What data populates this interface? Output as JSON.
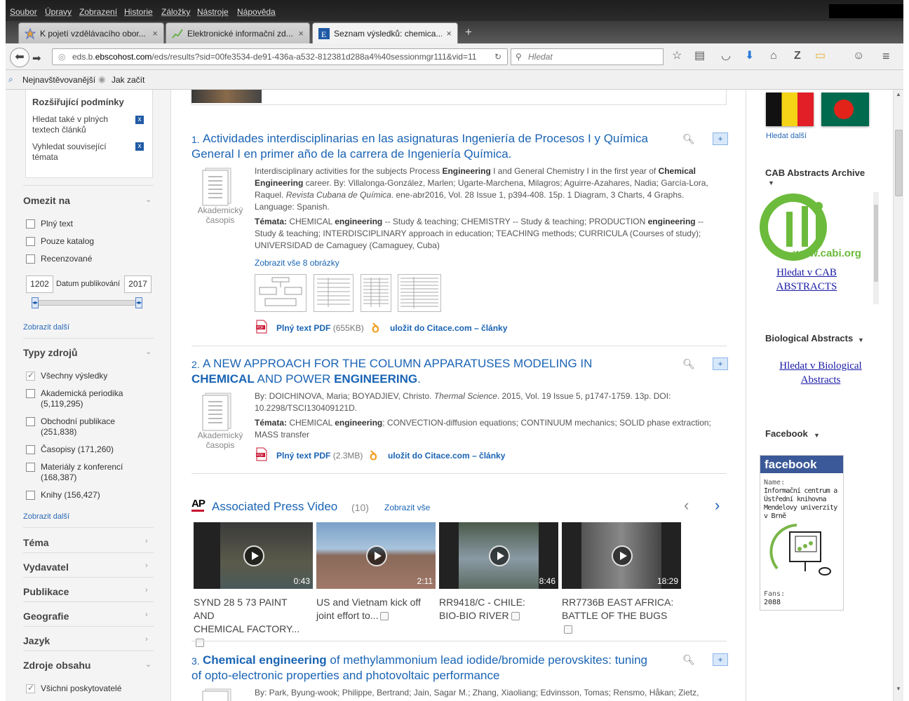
{
  "menu": [
    "Soubor",
    "Úpravy",
    "Zobrazení",
    "Historie",
    "Záložky",
    "Nástroje",
    "Nápověda"
  ],
  "tabs": [
    {
      "title": "K pojetí vzdělávacího obor...",
      "close": "×"
    },
    {
      "title": "Elektronické informační zd...",
      "close": "×"
    },
    {
      "title": "Seznam výsledků: chemica...",
      "close": "×"
    }
  ],
  "new_tab": "+",
  "url": {
    "prefix": "eds.b.",
    "domain": "ebscohost.com",
    "path": "/eds/results?sid=00fe3534-de91-436a-a532-812381d288a4%40sessionmgr111&vid=11"
  },
  "search_placeholder": "Hledat",
  "bookmarks": [
    "Nejnavštěvovanější",
    "Jak začít"
  ],
  "left": {
    "rozsirujici": "Rozšiřující podmínky",
    "opt1": "Hledat také v plných textech článků",
    "opt2": "Vyhledat související témata",
    "omezit": "Omezit na",
    "limits": [
      "Plný text",
      "Pouze katalog",
      "Recenzované"
    ],
    "date_from": "1202",
    "date_label": "Datum publikování",
    "date_to": "2017",
    "more": "Zobrazit další",
    "typy": "Typy zdrojů",
    "types": [
      "Všechny výsledky",
      "Akademická periodika (5,119,295)",
      "Obchodní publikace (251,838)",
      "Časopisy (171,260)",
      "Materiály z konferencí (168,387)",
      "Knihy (156,427)"
    ],
    "facets": [
      "Téma",
      "Vydavatel",
      "Publikace",
      "Geografie",
      "Jazyk",
      "Zdroje obsahu"
    ],
    "providers": "Všichni poskytovatelé"
  },
  "results": [
    {
      "num": "1.",
      "title": "Actividades interdisciplinarias en las asignaturas Ingeniería de Procesos I y Química General I en primer año de la carrera de Ingeniería Química.",
      "type": "Akademický časopis",
      "abstract_a": "Interdisciplinary activities for the subjects Process ",
      "kw1": "Engineering",
      "abstract_b": " I and General Chemistry I in the first year of ",
      "kw2": "Chemical",
      "abstract_c": " ",
      "kw3": "Engineering",
      "abstract_d": " career. By: Villalonga-González, Marlen; Ugarte-Marchena, Milagros; Aguirre-Azahares, Nadia; García-Lora, Raquel. ",
      "journal": "Revista Cubana de Química",
      "abstract_e": ". ene-abr2016, Vol. 28 Issue 1, p394-408. 15p. 1 Diagram, 3 Charts, 4 Graphs. Language: Spanish.",
      "subj_label": "Témata:",
      "subjects_a": " CHEMICAL ",
      "subj_kw": "engineering",
      "subjects_b": " -- Study & teaching; CHEMISTRY -- Study & teaching; PRODUCTION ",
      "subj_kw2": "engineering",
      "subjects_c": " -- Study & teaching; INTERDISCIPLINARY approach in education; TEACHING methods; CURRICULA (Courses of study); UNIVERSIDAD de Camaguey (Camaguey, Cuba)",
      "images_link": "Zobrazit vše 8 obrázky",
      "pdf": "Plný text PDF",
      "pdf_size": "(655KB)",
      "citace": "uložit do Citace.com – články"
    },
    {
      "num": "2.",
      "title_a": "A NEW APPROACH FOR THE COLUMN APPARATUSES MODELING IN ",
      "title_kw1": "CHEMICAL",
      "title_b": " AND POWER ",
      "title_kw2": "ENGINEERING",
      "title_c": ".",
      "type": "Akademický časopis",
      "authors": "By: DOICHINOVA, Maria; BOYADJIEV, Christo. ",
      "journal": "Thermal Science",
      "details": ". 2015, Vol. 19 Issue 5, p1747-1759. 13p. DOI: 10.2298/TSCI130409121D.",
      "subj_label": "Témata:",
      "subjects_a": " CHEMICAL ",
      "subj_kw": "engineering",
      "subjects_b": "; CONVECTION-diffusion equations; CONTINUUM mechanics; SOLID phase extraction; MASS transfer",
      "pdf": "Plný text PDF",
      "pdf_size": "(2.3MB)",
      "citace": "uložit do Citace.com – články"
    },
    {
      "num": "3.",
      "title_kw1": "Chemical engineering",
      "title_a": " of methylammonium lead iodide/bromide perovskites: tuning of opto-electronic properties and photovoltaic performance",
      "authors": "By: Park, Byung-wook; Philippe, Bertrand; Jain, Sagar M.; Zhang, Xiaoliang; Edvinsson, Tomas; Rensmo, Håkan; Zietz,"
    }
  ],
  "ap": {
    "logo": "AP",
    "title": "Associated Press Video",
    "count": "(10)",
    "link": "Zobrazit vše",
    "prev": "‹",
    "next": "›",
    "videos": [
      {
        "dur": "0:43",
        "cap1": "SYND 28 5 73 PAINT AND",
        "cap2": "CHEMICAL FACTORY..."
      },
      {
        "dur": "2:11",
        "cap1": "US and Vietnam kick off",
        "cap2": "joint effort to..."
      },
      {
        "dur": "8:46",
        "cap1": "RR9418/C - CHILE:",
        "cap2": "BIO-BIO RIVER"
      },
      {
        "dur": "18:29",
        "cap1": "RR7736B EAST AFRICA:",
        "cap2": "BATTLE OF THE BUGS"
      }
    ]
  },
  "right": {
    "more": "Hledat další",
    "cab_title": "CAB Abstracts Archive",
    "cab_logo": "www.cabi.org",
    "cab_link1": "Hledat v CAB",
    "cab_link2": "ABSTRACTS",
    "bio_title": "Biological Abstracts",
    "bio_link1": "Hledat v Biological",
    "bio_link2": "Abstracts",
    "fb_title": "Facebook",
    "fb_logo": "facebook",
    "fb_name_label": "Name:",
    "fb_name": "Informační centrum a Ústřední knihovna Mendelovy univerzity v Brně",
    "fb_fans_label": "Fans:",
    "fb_fans": "2088"
  },
  "colors": {
    "link": "#1a64b4",
    "pdf_red": "#c8102e",
    "fb_blue": "#3b5998"
  }
}
